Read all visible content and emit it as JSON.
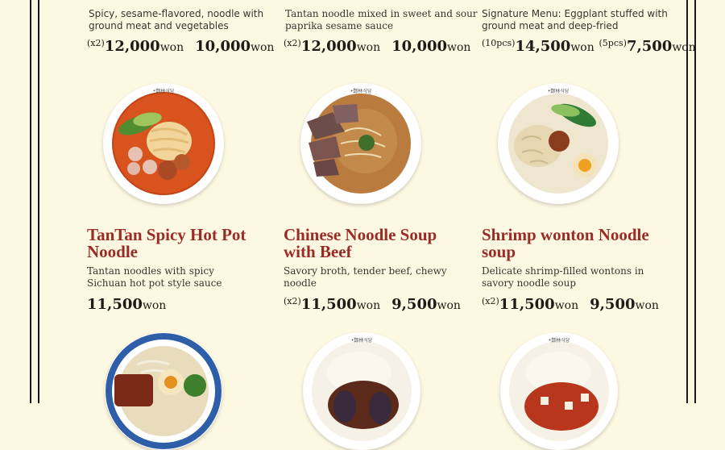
{
  "top_row": [
    {
      "desc": "Spicy, sesame-flavored, noodle with ground meat and vegetables",
      "prefix": "(x2)",
      "price1": "12,000",
      "price2": "10,000",
      "unit": "won"
    },
    {
      "desc": "Tantan noodle mixed in sweet and sour paprika sesame sauce",
      "prefix": "(x2)",
      "price1": "12,000",
      "price2": "10,000",
      "unit": "won"
    },
    {
      "desc": "Signature Menu: Eggplant stuffed with ground meat and deep-fried",
      "prefix1": "(10pcs)",
      "price1": "14,500",
      "prefix2": "(5pcs)",
      "price2": "7,500",
      "unit": "won"
    }
  ],
  "middle_row": [
    {
      "title": "TanTan Spicy Hot Pot Noodle",
      "desc": "Tantan noodles with spicy Sichuan hot pot style sauce",
      "price1": "11,500",
      "unit": "won"
    },
    {
      "title": "Chinese Noodle Soup with Beef",
      "desc": "Savory broth, tender beef, chewy noodle",
      "prefix": "(x2)",
      "price1": "11,500",
      "price2": "9,500",
      "unit": "won"
    },
    {
      "title": "Shrimp wonton Noodle soup",
      "desc": "Delicate shrimp-filled wontons in savory noodle soup",
      "prefix": "(x2)",
      "price1": "11,500",
      "price2": "9,500",
      "unit": "won"
    }
  ],
  "bowl_label": "•鄭林식당"
}
